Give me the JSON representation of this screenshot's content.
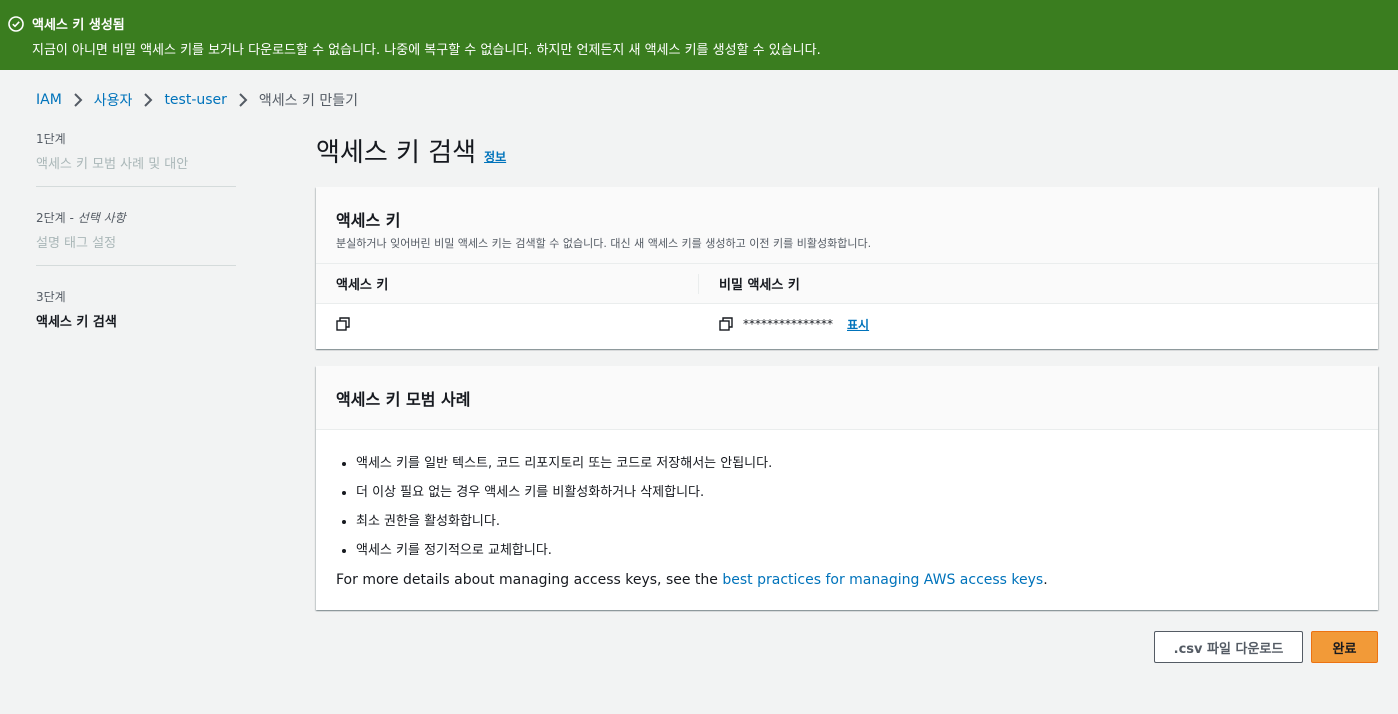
{
  "flash": {
    "title": "액세스 키 생성됨",
    "message": "지금이 아니면 비밀 액세스 키를 보거나 다운로드할 수 없습니다. 나중에 복구할 수 없습니다. 하지만 언제든지 새 액세스 키를 생성할 수 있습니다.",
    "icon": "check-circle-icon"
  },
  "breadcrumb": {
    "items": [
      "IAM",
      "사용자",
      "test-user"
    ],
    "current": "액세스 키 만들기"
  },
  "steps": [
    {
      "num": "1단계",
      "label": "액세스 키 모범 사례 및 대안"
    },
    {
      "num": "2단계",
      "optional": "- 선택 사항",
      "label": "설명 태그 설정"
    },
    {
      "num": "3단계",
      "label": "액세스 키 검색"
    }
  ],
  "page": {
    "title": "액세스 키 검색",
    "info": "정보"
  },
  "access_key_card": {
    "title": "액세스 키",
    "description": "분실하거나 잊어버린 비밀 액세스 키는 검색할 수 없습니다. 대신 새 액세스 키를 생성하고 이전 키를 비활성화합니다.",
    "col_access_key": "액세스 키",
    "col_secret_key": "비밀 액세스 키",
    "access_key_value": "",
    "secret_key_value": "***************",
    "show_label": "표시"
  },
  "practices_card": {
    "title": "액세스 키 모범 사례",
    "items": [
      "액세스 키를 일반 텍스트, 코드 리포지토리 또는 코드로 저장해서는 안됩니다.",
      "더 이상 필요 없는 경우 액세스 키를 비활성화하거나 삭제합니다.",
      "최소 권한을 활성화합니다.",
      "액세스 키를 정기적으로 교체합니다."
    ],
    "details_prefix": "For more details about managing access keys, see the ",
    "details_link": "best practices for managing AWS access keys",
    "details_suffix": "."
  },
  "buttons": {
    "csv": ".csv 파일 다운로드",
    "done": "완료"
  },
  "colors": {
    "flash_bg": "#3a7d1f",
    "link": "#0073bb",
    "primary": "#f29a38"
  }
}
